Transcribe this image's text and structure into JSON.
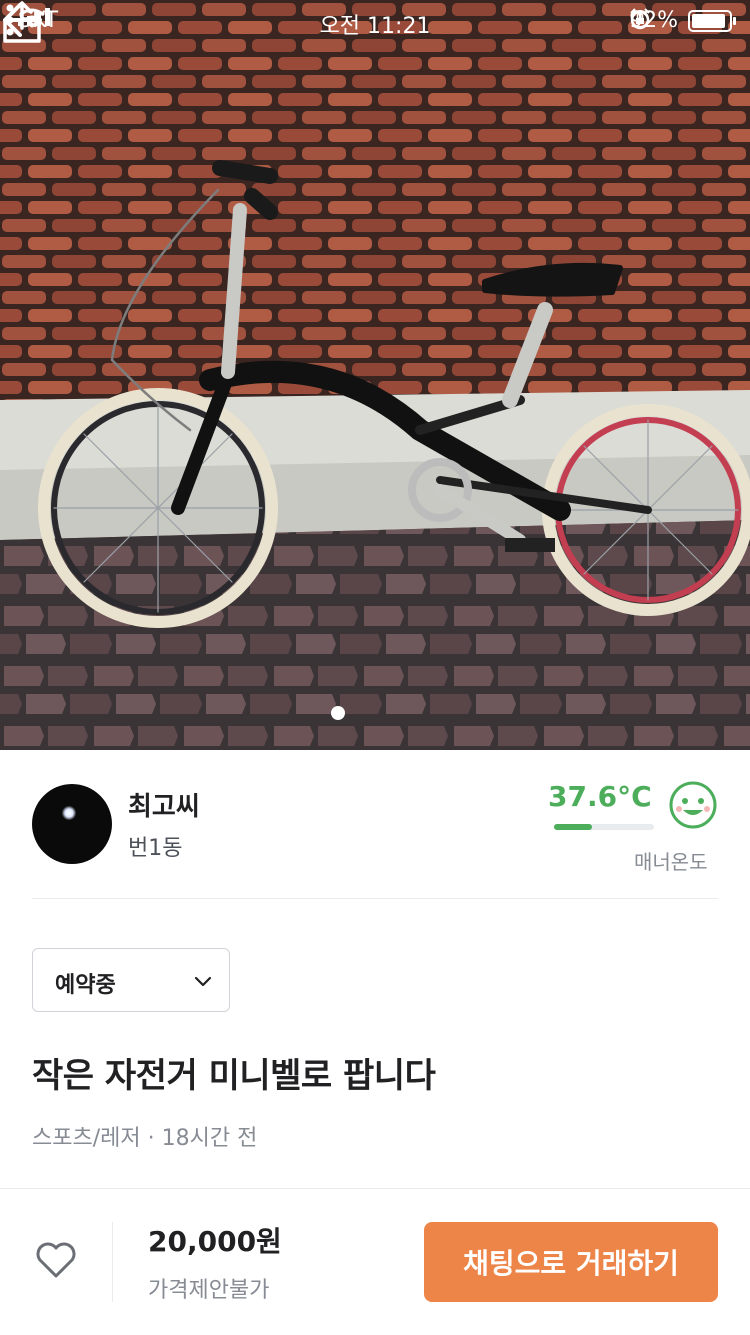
{
  "status_bar": {
    "carrier": "SKT",
    "time": "오전 11:21",
    "battery": "92%",
    "battery_level": 0.92
  },
  "top_nav": {
    "back_icon": "arrow-left-icon",
    "share_icon": "share-icon",
    "more_icon": "more-vertical-icon"
  },
  "photo": {
    "page_count": 1,
    "current_page": 1
  },
  "seller": {
    "name": "최고씨",
    "location": "번1동",
    "manner_temp": "37.6°C",
    "manner_temp_value": 37.6,
    "manner_label": "매너온도",
    "temp_color": "#4cae5b"
  },
  "listing": {
    "status": "예약중",
    "title": "작은 자전거 미니벨로 팝니다",
    "category": "스포츠/레저",
    "time_ago": "18시간 전",
    "separator": " · "
  },
  "bottom_bar": {
    "price": "20,000원",
    "negotiable": "가격제안불가",
    "chat_button": "채팅으로 거래하기",
    "accent": "#ee8548"
  }
}
